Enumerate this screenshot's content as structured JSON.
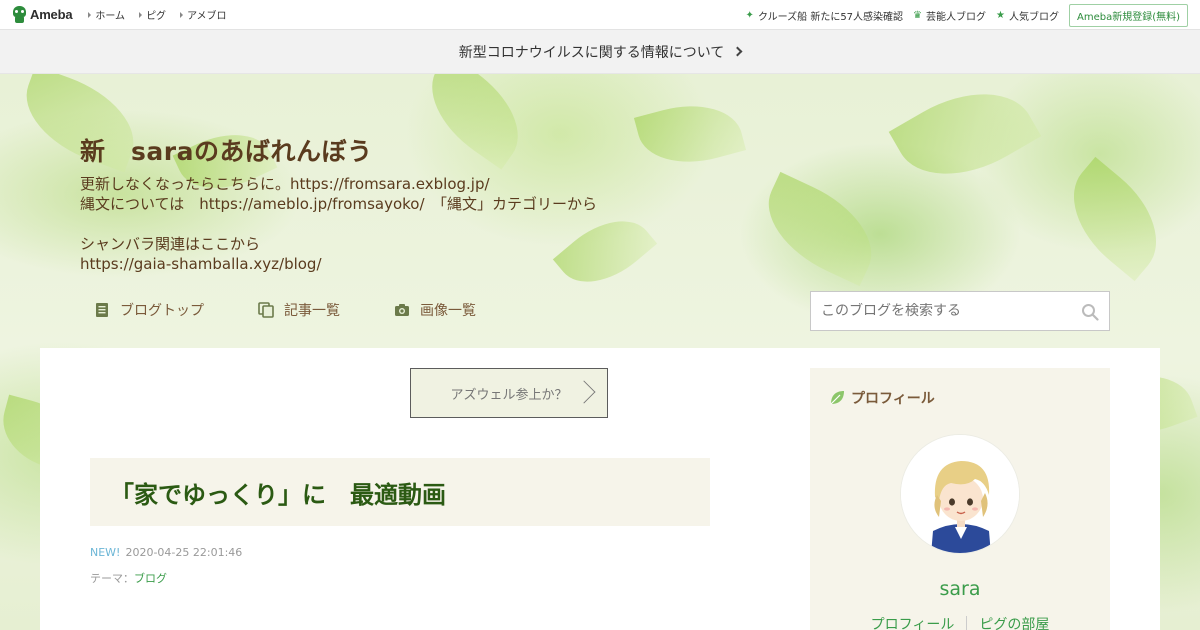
{
  "topbar": {
    "logo_text": "Ameba",
    "nav": [
      {
        "label": "ホーム"
      },
      {
        "label": "ピグ"
      },
      {
        "label": "アメブロ"
      }
    ],
    "right_links": [
      {
        "icon": "sparkle-icon",
        "glyph": "✦",
        "label": "クルーズ船 新たに57人感染確認"
      },
      {
        "icon": "crown-icon",
        "glyph": "♛",
        "label": "芸能人ブログ"
      },
      {
        "icon": "star-icon",
        "glyph": "★",
        "label": "人気ブログ"
      }
    ],
    "register_label": "Ameba新規登録(無料)"
  },
  "notice": {
    "text": "新型コロナウイルスに関する情報について"
  },
  "blog": {
    "title": "新　saraのあばれんぼう",
    "description_lines": [
      "更新しなくなったらこちらに。https://fromsara.exblog.jp/",
      "縄文については　https://ameblo.jp/fromsayoko/　「縄文」カテゴリーから",
      "",
      "シャンバラ関連はここから",
      "https://gaia-shamballa.xyz/blog/"
    ],
    "nav": [
      {
        "icon": "document-icon",
        "label": "ブログトップ"
      },
      {
        "icon": "copy-icon",
        "label": "記事一覧"
      },
      {
        "icon": "camera-icon",
        "label": "画像一覧"
      }
    ],
    "search_placeholder": "このブログを検索する"
  },
  "main": {
    "banner_text": "アズウェル参上か？",
    "article": {
      "title": "「家でゆっくり」に　最適動画",
      "new_label": "NEW!",
      "datetime": "2020-04-25 22:01:46",
      "theme_prefix": "テーマ：",
      "theme": "ブログ"
    }
  },
  "sidebar": {
    "profile": {
      "heading": "プロフィール",
      "name": "sara",
      "links": [
        "プロフィール",
        "ピグの部屋"
      ]
    }
  },
  "colors": {
    "brand_green": "#2d8c3c",
    "link_green": "#3a9c4a",
    "title_brown": "#5a3b1e",
    "article_title_green": "#2b5a13"
  }
}
